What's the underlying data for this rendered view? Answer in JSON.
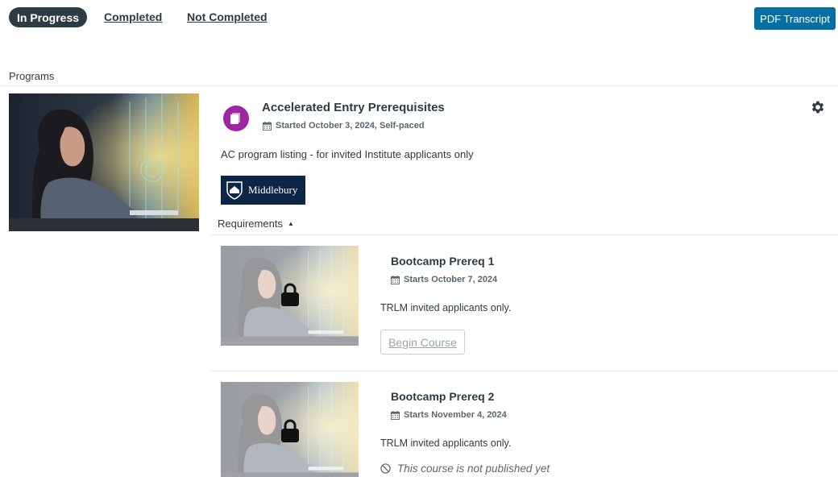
{
  "tabs": {
    "in_progress": "In Progress",
    "completed": "Completed",
    "not_completed": "Not Completed"
  },
  "pdf_button": "PDF Transcript",
  "section_label": "Programs",
  "program": {
    "title": "Accelerated Entry Prerequisites",
    "meta": "Started October 3, 2024, Self-paced",
    "description": "AC program listing - for invited Institute applicants only",
    "logo_text": "Middlebury",
    "icon": "program-icon",
    "accent_color": "#9c27a0"
  },
  "requirements_label": "Requirements",
  "courses": [
    {
      "title": "Bootcamp Prereq 1",
      "meta": "Starts October 7, 2024",
      "description": "TRLM invited applicants only.",
      "button": "Begin Course"
    },
    {
      "title": "Bootcamp Prereq 2",
      "meta": "Starts November 4, 2024",
      "description": "TRLM invited applicants only.",
      "status": "This course is not published yet"
    }
  ],
  "colors": {
    "primary_dark": "#2d3b45",
    "button_blue": "#0770a3",
    "logo_navy": "#0d2645"
  }
}
